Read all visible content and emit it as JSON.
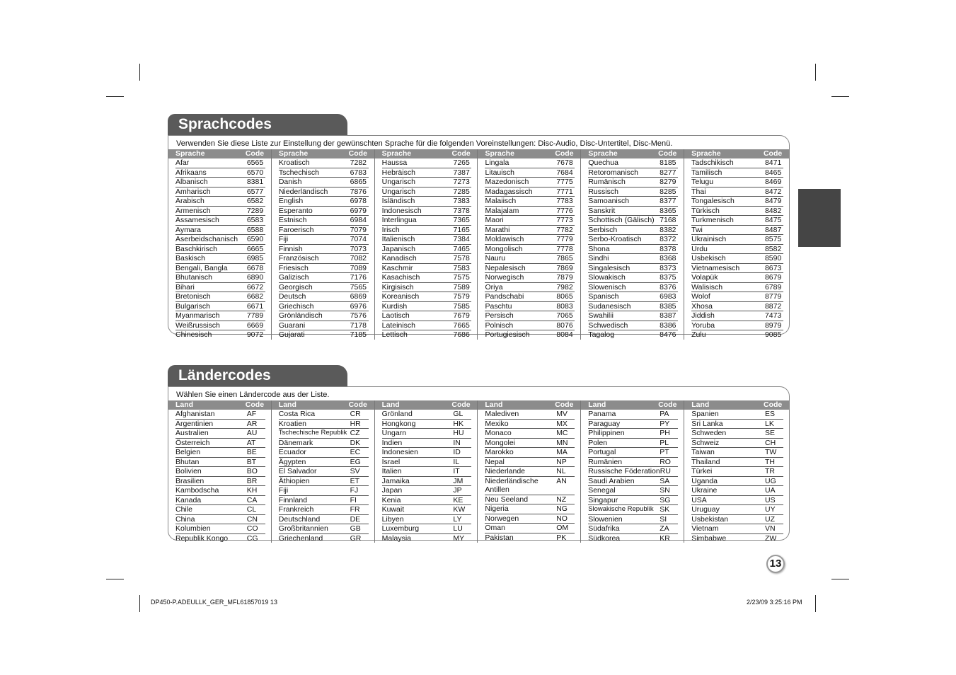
{
  "sprachcodes": {
    "title": "Sprachcodes",
    "intro": "Verwenden Sie diese Liste zur Einstellung der gewünschten Sprache für die folgenden Voreinstellungen: Disc-Audio, Disc-Untertitel, Disc-Menü.",
    "col_label": "Sprache",
    "code_label": "Code",
    "columns": [
      [
        [
          "Afar",
          "6565"
        ],
        [
          "Afrikaans",
          "6570"
        ],
        [
          "Albanisch",
          "8381"
        ],
        [
          "Amharisch",
          "6577"
        ],
        [
          "Arabisch",
          "6582"
        ],
        [
          "Armenisch",
          "7289"
        ],
        [
          "Assamesisch",
          "6583"
        ],
        [
          "Aymara",
          "6588"
        ],
        [
          "Aserbeidschanisch",
          "6590"
        ],
        [
          "Baschkirisch",
          "6665"
        ],
        [
          "Baskisch",
          "6985"
        ],
        [
          "Bengali, Bangla",
          "6678"
        ],
        [
          "Bhutanisch",
          "6890"
        ],
        [
          "Bihari",
          "6672"
        ],
        [
          "Bretonisch",
          "6682"
        ],
        [
          "Bulgarisch",
          "6671"
        ],
        [
          "Myanmarisch",
          "7789"
        ],
        [
          "Weißrussisch",
          "6669"
        ],
        [
          "Chinesisch",
          "9072"
        ]
      ],
      [
        [
          "Kroatisch",
          "7282"
        ],
        [
          "Tschechisch",
          "6783"
        ],
        [
          "Danish",
          "6865"
        ],
        [
          "Niederländisch",
          "7876"
        ],
        [
          "English",
          "6978"
        ],
        [
          "Esperanto",
          "6979"
        ],
        [
          "Estnisch",
          "6984"
        ],
        [
          "Faroerisch",
          "7079"
        ],
        [
          "Fiji",
          "7074"
        ],
        [
          "Finnish",
          "7073"
        ],
        [
          "Französisch",
          "7082"
        ],
        [
          "Friesisch",
          "7089"
        ],
        [
          "Galizisch",
          "7176"
        ],
        [
          "Georgisch",
          "7565"
        ],
        [
          "Deutsch",
          "6869"
        ],
        [
          "Griechisch",
          "6976"
        ],
        [
          "Grönländisch",
          "7576"
        ],
        [
          "Guarani",
          "7178"
        ],
        [
          "Gujarati",
          "7185"
        ]
      ],
      [
        [
          "Haussa",
          "7265"
        ],
        [
          "Hebräisch",
          "7387"
        ],
        [
          "Ungarisch",
          "7273"
        ],
        [
          "Ungarisch",
          "7285"
        ],
        [
          "Isländisch",
          "7383"
        ],
        [
          "Indonesisch",
          "7378"
        ],
        [
          "Interlingua",
          "7365"
        ],
        [
          "Irisch",
          "7165"
        ],
        [
          "Italienisch",
          "7384"
        ],
        [
          "Japanisch",
          "7465"
        ],
        [
          "Kanadisch",
          "7578"
        ],
        [
          "Kaschmir",
          "7583"
        ],
        [
          "Kasachisch",
          "7575"
        ],
        [
          "Kirgisisch",
          "7589"
        ],
        [
          "Koreanisch",
          "7579"
        ],
        [
          "Kurdish",
          "7585"
        ],
        [
          "Laotisch",
          "7679"
        ],
        [
          "Lateinisch",
          "7665"
        ],
        [
          "Lettisch",
          "7686"
        ]
      ],
      [
        [
          "Lingala",
          "7678"
        ],
        [
          "Litauisch",
          "7684"
        ],
        [
          "Mazedonisch",
          "7775"
        ],
        [
          "Madagassisch",
          "7771"
        ],
        [
          "Malaiisch",
          "7783"
        ],
        [
          "Malajalam",
          "7776"
        ],
        [
          "Maori",
          "7773"
        ],
        [
          "Marathi",
          "7782"
        ],
        [
          "Moldawisch",
          "7779"
        ],
        [
          "Mongolisch",
          "7778"
        ],
        [
          "Nauru",
          "7865"
        ],
        [
          "Nepalesisch",
          "7869"
        ],
        [
          "Norwegisch",
          "7879"
        ],
        [
          "Oriya",
          "7982"
        ],
        [
          "Pandschabi",
          "8065"
        ],
        [
          "Paschtu",
          "8083"
        ],
        [
          "Persisch",
          "7065"
        ],
        [
          "Polnisch",
          "8076"
        ],
        [
          "Portugiesisch",
          "8084"
        ]
      ],
      [
        [
          "Quechua",
          "8185"
        ],
        [
          "Retoromanisch",
          "8277"
        ],
        [
          "Rumänisch",
          "8279"
        ],
        [
          "Russisch",
          "8285"
        ],
        [
          "Samoanisch",
          "8377"
        ],
        [
          "Sanskrit",
          "8365"
        ],
        [
          "Schottisch (Gälisch)",
          "7168"
        ],
        [
          "Serbisch",
          "8382"
        ],
        [
          "Serbo-Kroatisch",
          "8372"
        ],
        [
          "Shona",
          "8378"
        ],
        [
          "Sindhi",
          "8368"
        ],
        [
          "Singalesisch",
          "8373"
        ],
        [
          "Slowakisch",
          "8375"
        ],
        [
          "Slowenisch",
          "8376"
        ],
        [
          "Spanisch",
          "6983"
        ],
        [
          "Sudanesisch",
          "8385"
        ],
        [
          "Swahilii",
          "8387"
        ],
        [
          "Schwedisch",
          "8386"
        ],
        [
          "Tagalog",
          "8476"
        ]
      ],
      [
        [
          "Tadschikisch",
          "8471"
        ],
        [
          "Tamilisch",
          "8465"
        ],
        [
          "Telugu",
          "8469"
        ],
        [
          "Thai",
          "8472"
        ],
        [
          "Tongalesisch",
          "8479"
        ],
        [
          "Türkisch",
          "8482"
        ],
        [
          "Turkmenisch",
          "8475"
        ],
        [
          "Twi",
          "8487"
        ],
        [
          "Ukrainisch",
          "8575"
        ],
        [
          "Urdu",
          "8582"
        ],
        [
          "Usbekisch",
          "8590"
        ],
        [
          "Vietnamesisch",
          "8673"
        ],
        [
          "Volapük",
          "8679"
        ],
        [
          "Walisisch",
          "6789"
        ],
        [
          "Wolof",
          "8779"
        ],
        [
          "Xhosa",
          "8872"
        ],
        [
          "Jiddish",
          "7473"
        ],
        [
          "Yoruba",
          "8979"
        ],
        [
          "Zulu",
          "9085"
        ]
      ]
    ]
  },
  "laendercodes": {
    "title": "Ländercodes",
    "intro": "Wählen Sie einen Ländercode aus der Liste.",
    "col_label": "Land",
    "code_label": "Code",
    "columns": [
      [
        [
          "Afghanistan",
          "AF"
        ],
        [
          "Argentinien",
          "AR"
        ],
        [
          "Australien",
          "AU"
        ],
        [
          "Österreich",
          "AT"
        ],
        [
          "Belgien",
          "BE"
        ],
        [
          "Bhutan",
          "BT"
        ],
        [
          "Bolivien",
          "BO"
        ],
        [
          "Brasilien",
          "BR"
        ],
        [
          "Kambodscha",
          "KH"
        ],
        [
          "Kanada",
          "CA"
        ],
        [
          "Chile",
          "CL"
        ],
        [
          "China",
          "CN"
        ],
        [
          "Kolumbien",
          "CO"
        ],
        [
          "Republik Kongo",
          "CG"
        ]
      ],
      [
        [
          "Costa Rica",
          "CR"
        ],
        [
          "Kroatien",
          "HR"
        ],
        [
          "Tschechische Republik",
          "CZ"
        ],
        [
          "Dänemark",
          "DK"
        ],
        [
          "Ecuador",
          "EC"
        ],
        [
          "Ägypten",
          "EG"
        ],
        [
          "El Salvador",
          "SV"
        ],
        [
          "Äthiopien",
          "ET"
        ],
        [
          "Fiji",
          "FJ"
        ],
        [
          "Finnland",
          "FI"
        ],
        [
          "Frankreich",
          "FR"
        ],
        [
          "Deutschland",
          "DE"
        ],
        [
          "Großbritannien",
          "GB"
        ],
        [
          "Griechenland",
          "GR"
        ]
      ],
      [
        [
          "Grönland",
          "GL"
        ],
        [
          "Hongkong",
          "HK"
        ],
        [
          "Ungarn",
          "HU"
        ],
        [
          "Indien",
          "IN"
        ],
        [
          "Indonesien",
          "ID"
        ],
        [
          "Israel",
          "IL"
        ],
        [
          "Italien",
          "IT"
        ],
        [
          "Jamaika",
          "JM"
        ],
        [
          "Japan",
          "JP"
        ],
        [
          "Kenia",
          "KE"
        ],
        [
          "Kuwait",
          "KW"
        ],
        [
          "Libyen",
          "LY"
        ],
        [
          "Luxemburg",
          "LU"
        ],
        [
          "Malaysia",
          "MY"
        ]
      ],
      [
        [
          "Malediven",
          "MV"
        ],
        [
          "Mexiko",
          "MX"
        ],
        [
          "Monaco",
          "MC"
        ],
        [
          "Mongolei",
          "MN"
        ],
        [
          "Marokko",
          "MA"
        ],
        [
          "Nepal",
          "NP"
        ],
        [
          "Niederlande",
          "NL"
        ],
        [
          "Niederländische Antillen",
          "AN"
        ],
        [
          "Neu Seeland",
          "NZ"
        ],
        [
          "Nigeria",
          "NG"
        ],
        [
          "Norwegen",
          "NO"
        ],
        [
          "Oman",
          "OM"
        ],
        [
          "Pakistan",
          "PK"
        ]
      ],
      [
        [
          "Panama",
          "PA"
        ],
        [
          "Paraguay",
          "PY"
        ],
        [
          "Philippinen",
          "PH"
        ],
        [
          "Polen",
          "PL"
        ],
        [
          "Portugal",
          "PT"
        ],
        [
          "Rumänien",
          "RO"
        ],
        [
          "Russische Föderation",
          "RU"
        ],
        [
          "Saudi Arabien",
          "SA"
        ],
        [
          "Senegal",
          "SN"
        ],
        [
          "Singapur",
          "SG"
        ],
        [
          "Slowakische Republik",
          "SK"
        ],
        [
          "Slowenien",
          "SI"
        ],
        [
          "Südafrika",
          "ZA"
        ],
        [
          "Südkorea",
          "KR"
        ]
      ],
      [
        [
          "Spanien",
          "ES"
        ],
        [
          "Sri Lanka",
          "LK"
        ],
        [
          "Schweden",
          "SE"
        ],
        [
          "Schweiz",
          "CH"
        ],
        [
          "Taiwan",
          "TW"
        ],
        [
          "Thailand",
          "TH"
        ],
        [
          "Türkei",
          "TR"
        ],
        [
          "Uganda",
          "UG"
        ],
        [
          "Ukraine",
          "UA"
        ],
        [
          "USA",
          "US"
        ],
        [
          "Uruguay",
          "UY"
        ],
        [
          "Usbekistan",
          "UZ"
        ],
        [
          "Vietnam",
          "VN"
        ],
        [
          "Simbabwe",
          "ZW"
        ]
      ]
    ]
  },
  "page_number": "13",
  "footer": {
    "left": "DP450-P.ADEULLK_GER_MFL61857019   13",
    "right": "2/23/09   3:25:16 PM"
  }
}
